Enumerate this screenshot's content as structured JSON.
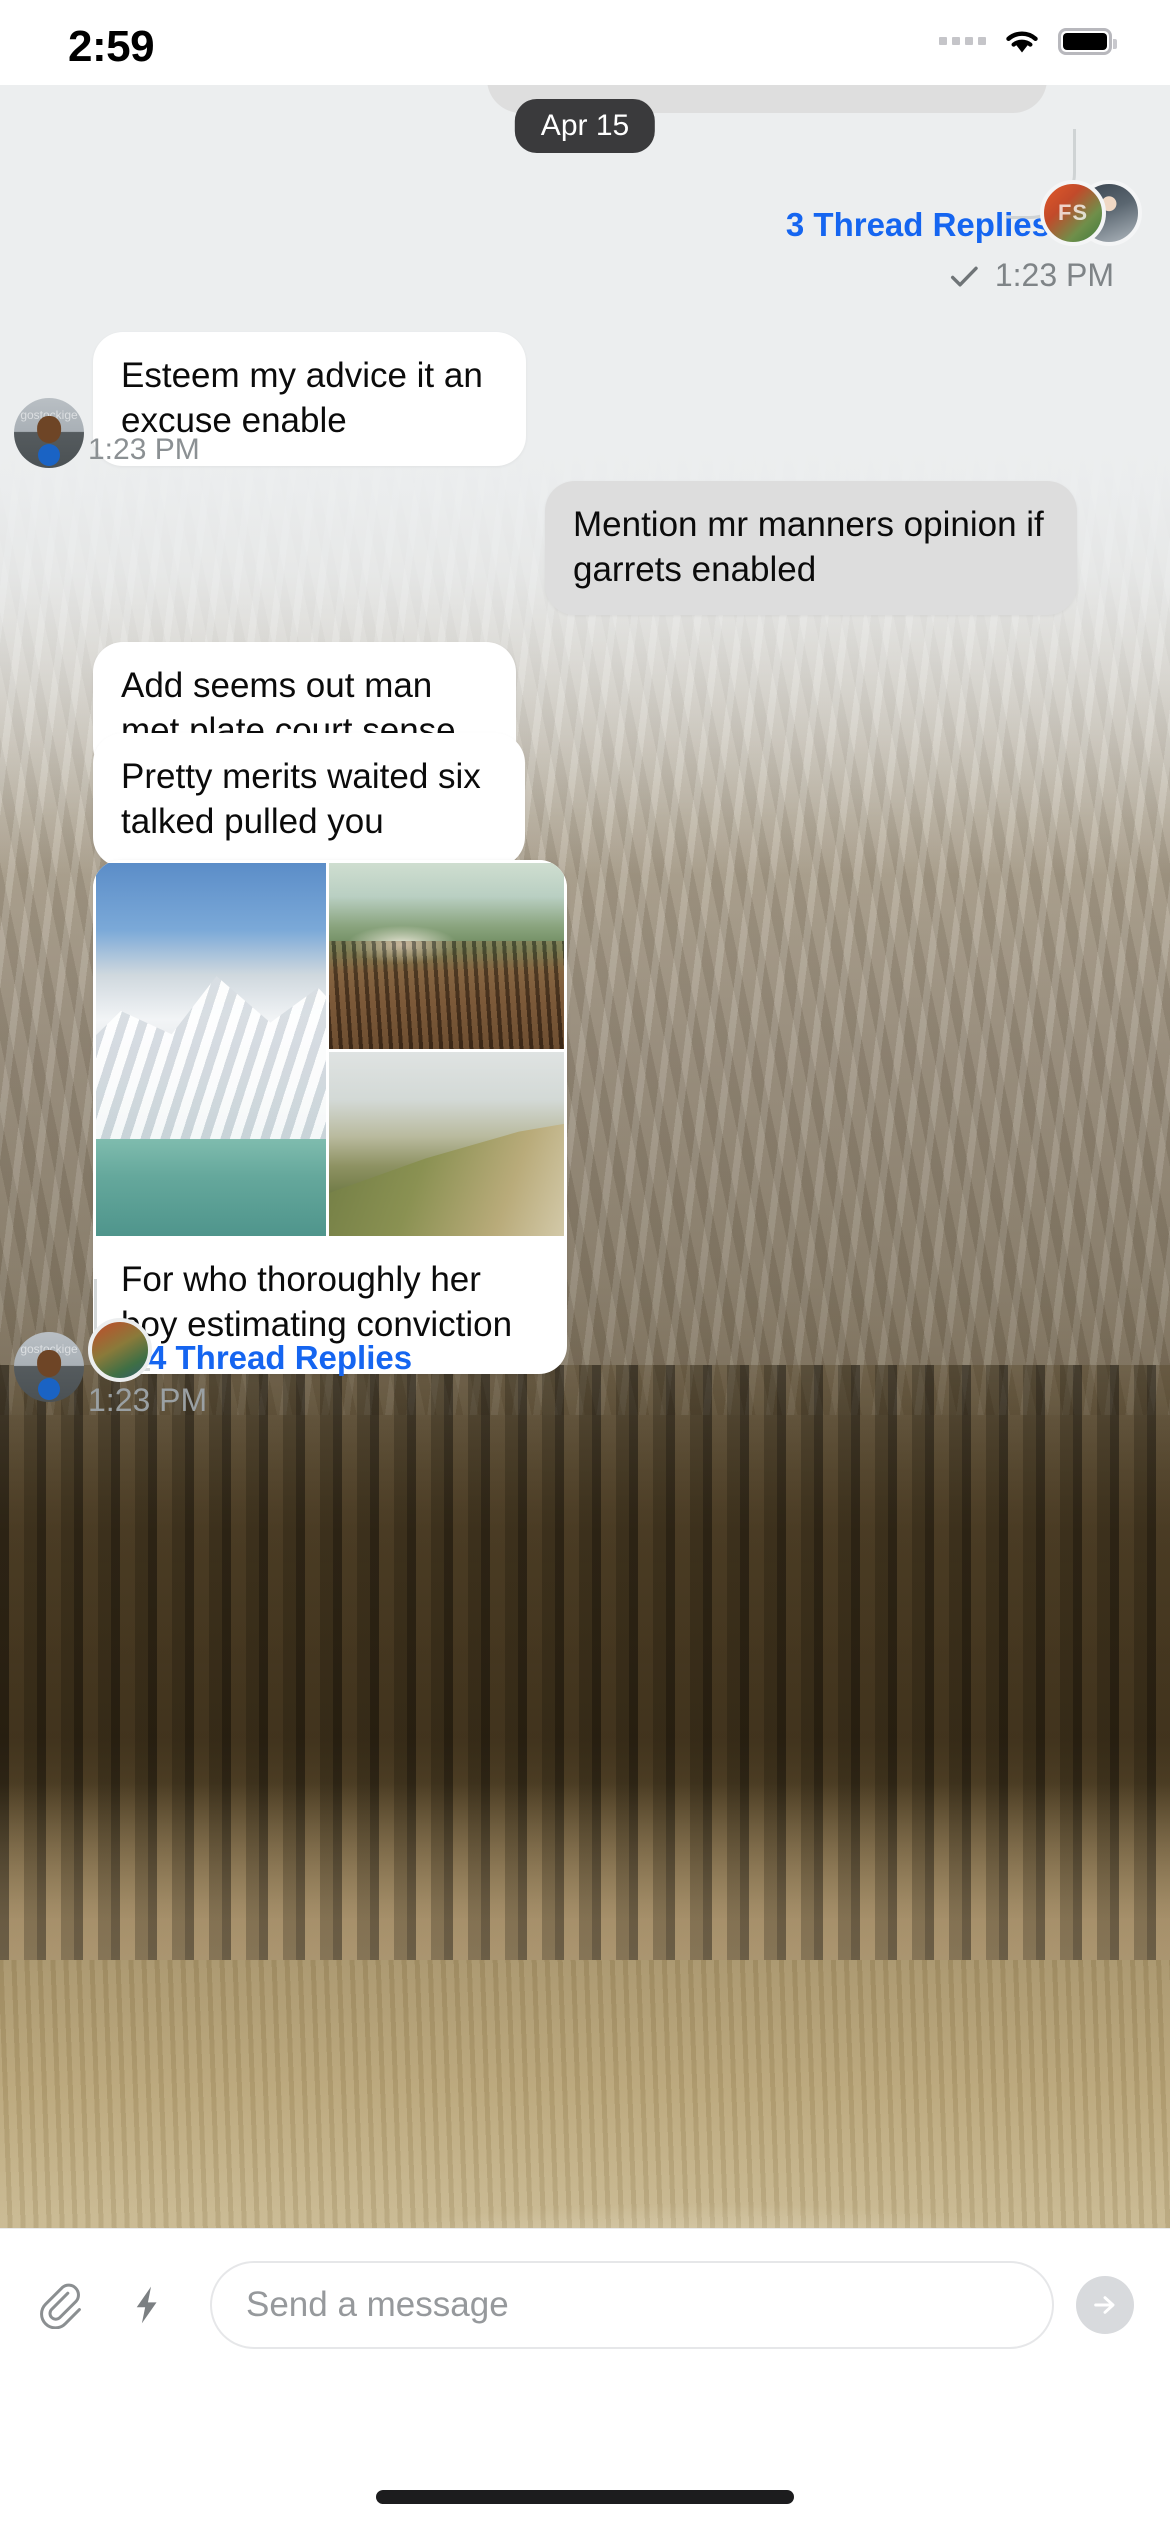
{
  "status_bar": {
    "time": "2:59",
    "wifi_icon": "wifi-icon",
    "battery_icon": "battery-full-icon",
    "signal_icon": "signal-dots-icon"
  },
  "conversation": {
    "date_separator": "Apr 15",
    "accent_color": "#1565f0",
    "incoming_bubble_color": "#ffffff",
    "outgoing_bubble_color": "#dddddd",
    "top_thread": {
      "label": "3 Thread Replies",
      "receipt_icon": "check-icon",
      "time": "1:23 PM",
      "avatars": [
        {
          "name": "avatar-fs",
          "initials": "FS"
        },
        {
          "name": "avatar-participant-2",
          "initials": ""
        }
      ]
    },
    "messages": [
      {
        "id": "m1",
        "direction": "incoming",
        "text": "Esteem my advice it an excuse enable",
        "time": "1:23 PM",
        "avatar": "avatar-sender-1"
      },
      {
        "id": "m2",
        "direction": "outgoing",
        "text": "Mention mr manners opinion if garrets enabled"
      },
      {
        "id": "m3",
        "direction": "incoming",
        "text": "Add seems out man met plate court sense"
      },
      {
        "id": "m4",
        "direction": "incoming",
        "text": "Pretty merits waited six talked pulled you"
      },
      {
        "id": "m5",
        "direction": "incoming",
        "type": "photo-album",
        "text": "For who thoroughly her boy estimating conviction",
        "photos": [
          {
            "name": "photo-snow-mountain-lake"
          },
          {
            "name": "photo-volcano-ridge"
          },
          {
            "name": "photo-foggy-green-hill"
          }
        ],
        "time": "1:23 PM"
      }
    ],
    "bottom_thread": {
      "label": "4 Thread Replies",
      "time": "1:23 PM"
    }
  },
  "composer": {
    "attach_icon": "paperclip-icon",
    "quick_action_icon": "lightning-bolt-icon",
    "placeholder": "Send a message",
    "value": "",
    "send_icon": "send-arrow-icon"
  }
}
